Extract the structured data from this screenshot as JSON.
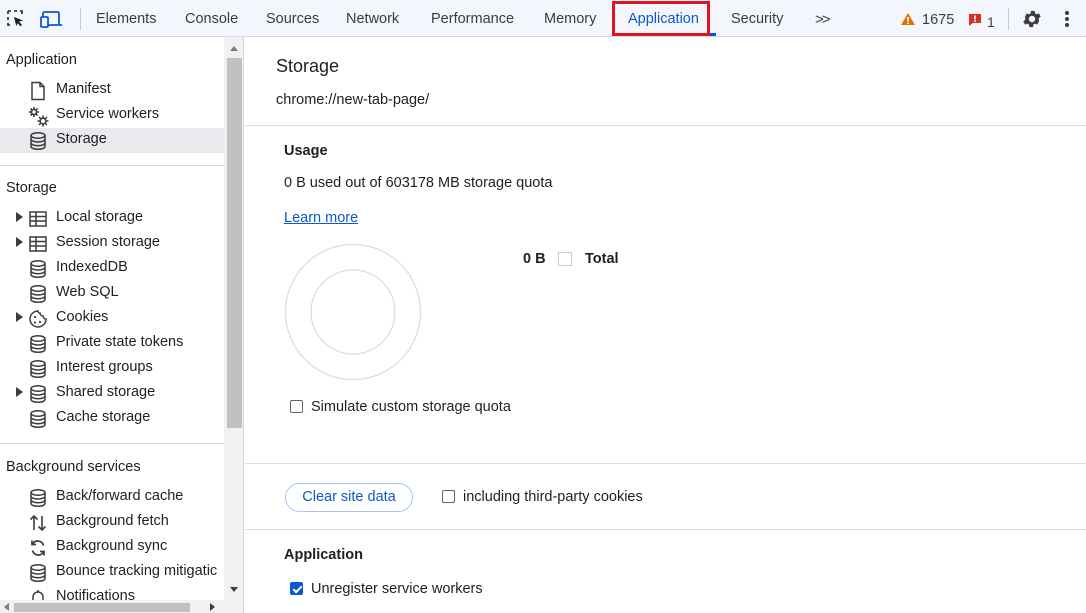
{
  "toolbar": {
    "tabs": [
      "Elements",
      "Console",
      "Sources",
      "Network",
      "Performance",
      "Memory",
      "Application",
      "Security"
    ],
    "more_tabs": ">>",
    "warnings_count": "1675",
    "errors_count": "1",
    "colors": {
      "accent": "#0b57d0",
      "highlight": "#e0141e",
      "warning": "#e37400",
      "error": "#d93025"
    }
  },
  "sidebar": {
    "application": {
      "title": "Application",
      "items": [
        {
          "label": "Manifest",
          "icon": "document-icon"
        },
        {
          "label": "Service workers",
          "icon": "gears-icon"
        },
        {
          "label": "Storage",
          "icon": "database-icon",
          "selected": true
        }
      ]
    },
    "storage": {
      "title": "Storage",
      "items": [
        {
          "label": "Local storage",
          "icon": "table-icon",
          "expandable": true
        },
        {
          "label": "Session storage",
          "icon": "table-icon",
          "expandable": true
        },
        {
          "label": "IndexedDB",
          "icon": "database-icon"
        },
        {
          "label": "Web SQL",
          "icon": "database-icon"
        },
        {
          "label": "Cookies",
          "icon": "cookie-icon",
          "expandable": true
        },
        {
          "label": "Private state tokens",
          "icon": "database-icon"
        },
        {
          "label": "Interest groups",
          "icon": "database-icon"
        },
        {
          "label": "Shared storage",
          "icon": "database-icon",
          "expandable": true
        },
        {
          "label": "Cache storage",
          "icon": "database-icon"
        }
      ]
    },
    "background": {
      "title": "Background services",
      "items": [
        {
          "label": "Back/forward cache",
          "icon": "database-icon"
        },
        {
          "label": "Background fetch",
          "icon": "up-down-arrows-icon"
        },
        {
          "label": "Background sync",
          "icon": "sync-icon"
        },
        {
          "label": "Bounce tracking mitigatic",
          "icon": "database-icon"
        },
        {
          "label": "Notifications",
          "icon": "bell-icon"
        }
      ]
    }
  },
  "main": {
    "title": "Storage",
    "origin": "chrome://new-tab-page/",
    "usage": {
      "heading": "Usage",
      "text": "0 B used out of 603178 MB storage quota",
      "learn_more": "Learn more",
      "legend_value": "0 B",
      "legend_label": "Total",
      "simulate_label": "Simulate custom storage quota",
      "simulate_checked": false
    },
    "clear": {
      "button_label": "Clear site data",
      "third_party_label": "including third-party cookies",
      "third_party_checked": false
    },
    "application_section": {
      "heading": "Application",
      "unregister_label": "Unregister service workers",
      "unregister_checked": true
    }
  }
}
